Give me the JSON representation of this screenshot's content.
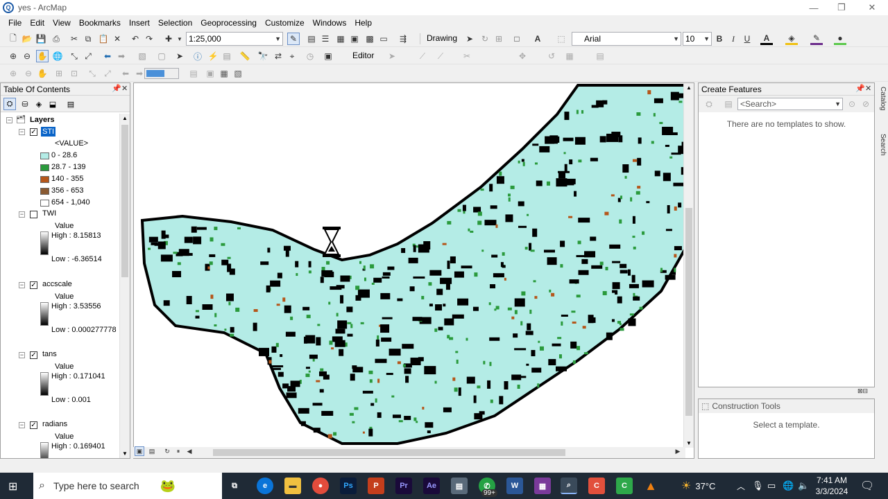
{
  "window": {
    "title": "yes - ArcMap",
    "app_icon": "arcmap-icon"
  },
  "menu": [
    "File",
    "Edit",
    "View",
    "Bookmarks",
    "Insert",
    "Selection",
    "Geoprocessing",
    "Customize",
    "Windows",
    "Help"
  ],
  "toolbar": {
    "scale": "1:25,000",
    "drawing_label": "Drawing",
    "font_name": "Arial",
    "font_size": "10",
    "bold": "B",
    "italic": "I",
    "underline": "U",
    "text_a": "A",
    "editor_label": "Editor"
  },
  "toc": {
    "title": "Table Of Contents",
    "root": "Layers",
    "layers": [
      {
        "name": "STI",
        "checked": true,
        "selected": true,
        "header": "<VALUE>",
        "classes": [
          {
            "label": "0 - 28.6",
            "color": "#b4ece6"
          },
          {
            "label": "28.7 - 139",
            "color": "#2a9a3c"
          },
          {
            "label": "140 - 355",
            "color": "#b5561a"
          },
          {
            "label": "356 - 653",
            "color": "#8a5a32"
          },
          {
            "label": "654 - 1,040",
            "color": "#ffffff"
          }
        ]
      },
      {
        "name": "TWI",
        "checked": false,
        "header": "Value",
        "high": "High : 8.15813",
        "low": "Low : -6.36514"
      },
      {
        "name": "accscale",
        "checked": true,
        "header": "Value",
        "high": "High : 3.53556",
        "low": "Low : 0.000277778"
      },
      {
        "name": "tans",
        "checked": true,
        "header": "Value",
        "high": "High : 0.171041",
        "low": "Low : 0.001"
      },
      {
        "name": "radians",
        "checked": true,
        "header": "Value",
        "high": "High : 0.169401",
        "low": ""
      }
    ]
  },
  "create_features": {
    "title": "Create Features",
    "search_placeholder": "<Search>",
    "empty_message": "There are no templates to show."
  },
  "construction_tools": {
    "title": "Construction Tools",
    "message": "Select a template."
  },
  "side_tabs": [
    "Catalog",
    "Search"
  ],
  "taskbar": {
    "search_placeholder": "Type here to search",
    "temperature": "37°C",
    "time": "7:41 AM",
    "date": "3/3/2024",
    "badge": "99+"
  },
  "colors": {
    "map_fill": "#b4ece6",
    "map_dark": "#000000",
    "map_green": "#2a9a3c",
    "map_brown": "#b5561a",
    "selection": "#0a64c8",
    "taskbar": "#1f2a36"
  }
}
